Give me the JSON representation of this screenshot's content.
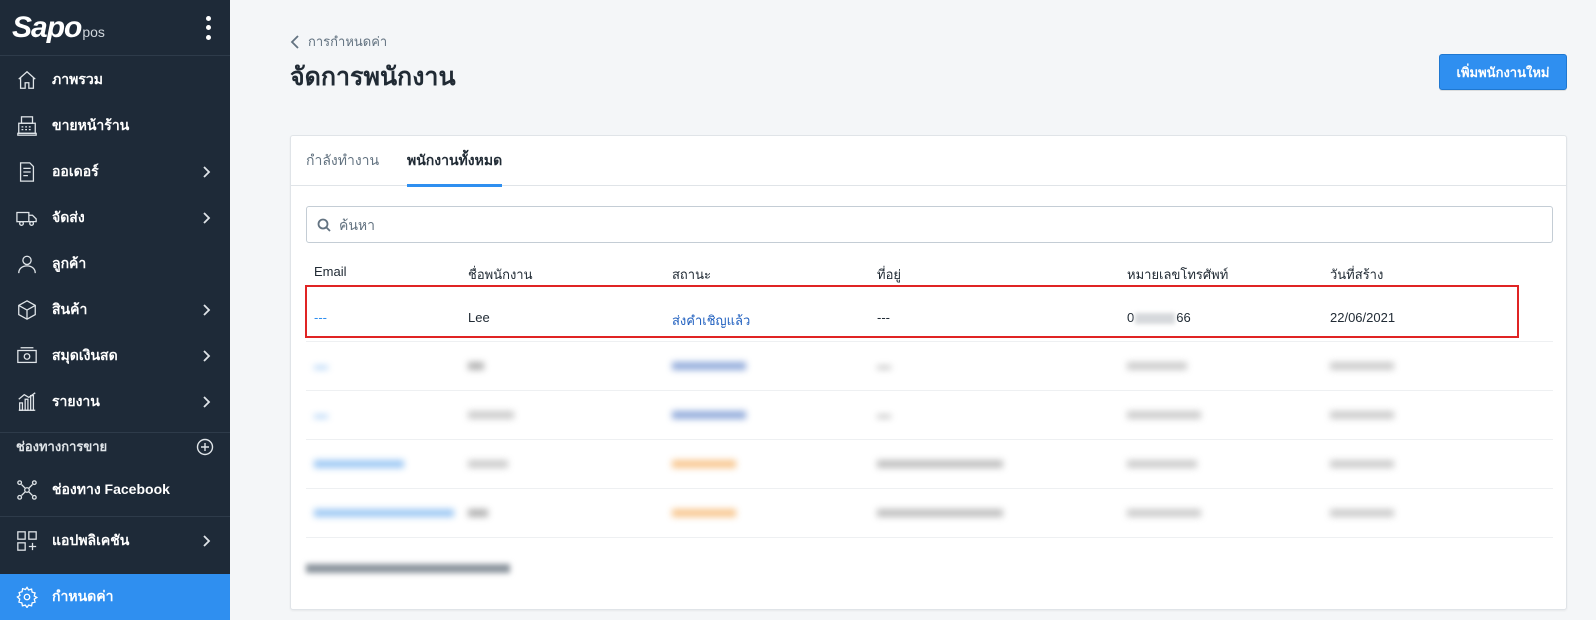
{
  "sidebar": {
    "logo_main": "Sapo",
    "logo_sub": "pos",
    "items": [
      {
        "label": "ภาพรวม",
        "icon": "home-icon"
      },
      {
        "label": "ขายหน้าร้าน",
        "icon": "cash-register-icon"
      },
      {
        "label": "ออเดอร์",
        "icon": "order-document-icon"
      },
      {
        "label": "จัดส่ง",
        "icon": "delivery-truck-icon"
      },
      {
        "label": "ลูกค้า",
        "icon": "user-icon"
      },
      {
        "label": "สินค้า",
        "icon": "box-icon"
      },
      {
        "label": "สมุดเงินสด",
        "icon": "cash-book-icon"
      },
      {
        "label": "รายงาน",
        "icon": "report-chart-icon"
      }
    ],
    "section_title": "ช่องทางการขาย",
    "channel_item": {
      "label": "ช่องทาง Facebook",
      "icon": "network-icon"
    },
    "apps_item": {
      "label": "แอปพลิเคชัน",
      "icon": "apps-grid-icon"
    },
    "settings_item": {
      "label": "กำหนดค่า",
      "icon": "gear-icon"
    }
  },
  "header": {
    "breadcrumb": "การกำหนดค่า",
    "title": "จัดการพนักงาน",
    "add_button": "เพิ่มพนักงานใหม่"
  },
  "tabs": [
    {
      "label": "กำลังทำงาน",
      "active": false
    },
    {
      "label": "พนักงานทั้งหมด",
      "active": true
    }
  ],
  "search": {
    "placeholder": "ค้นหา",
    "value": ""
  },
  "table": {
    "columns": [
      "Email",
      "ชื่อพนักงาน",
      "สถานะ",
      "ที่อยู่",
      "หมายเลขโทรศัพท์",
      "วันที่สร้าง"
    ],
    "rows": [
      {
        "email": "---",
        "name": "Lee",
        "status": "ส่งคำเชิญแล้ว",
        "address": "---",
        "phone_start": "0",
        "phone_end": "66",
        "created": "22/06/2021"
      }
    ]
  },
  "colors": {
    "sidebar_bg": "#1e2a38",
    "accent": "#2f8ff0",
    "highlight": "#e02424",
    "status_invited": "#1f5fbf",
    "status_active": "#f59a23"
  }
}
